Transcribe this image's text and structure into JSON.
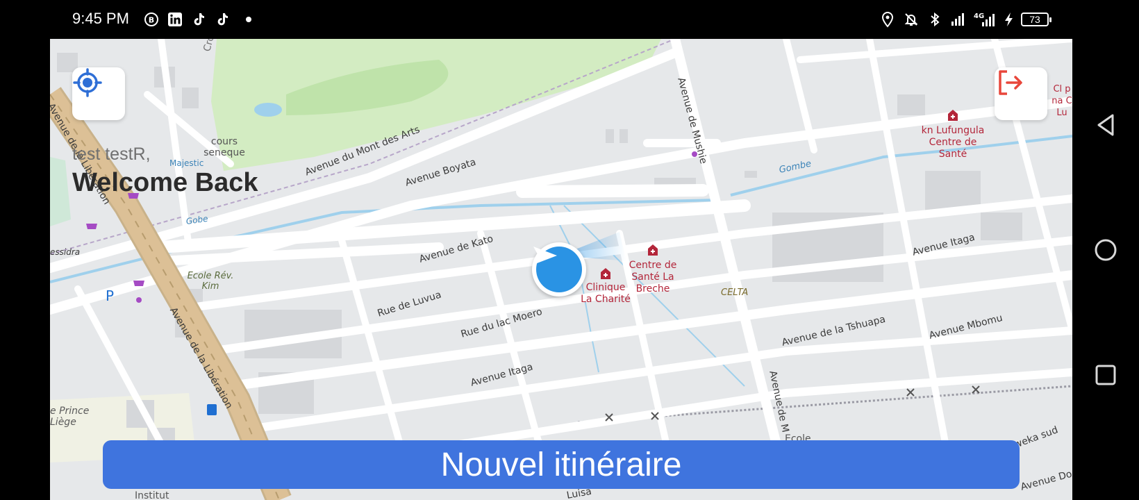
{
  "status_bar": {
    "time": "9:45 PM",
    "left_icons": [
      "b-circle-icon",
      "linkedin-icon",
      "tiktok-icon",
      "tiktok-icon"
    ],
    "right_icons": [
      "location-icon",
      "bell-off-icon",
      "bluetooth-icon",
      "signal-icon",
      "signal-4g-icon",
      "charging-icon"
    ],
    "network_label": "4G",
    "battery": "73"
  },
  "greeting": {
    "user": "test testR,",
    "title": "Welcome Back"
  },
  "map": {
    "streets": [
      "Avenue du Mont des Arts",
      "Avenue Boyata",
      "Avenue de Kato",
      "Rue de Luvua",
      "Rue du lac Moero",
      "Avenue Itaga",
      "Avenue Itaga",
      "Avenue de la Tshuapa",
      "Avenue Mbomu",
      "Avenue de Mushie",
      "Avenue de la Libération",
      "Avenue de la Libération",
      "Croix",
      "Gombe",
      "Gobe",
      "essidra",
      "Avenue de M",
      "mweka sud",
      "Avenue Do",
      "Luisa",
      "Rue",
      "Institut",
      "Ecole"
    ],
    "places": [
      "cours seneque",
      "Ecole Rév. Kim",
      "CELTA",
      "e Prince Liège",
      "Majestic"
    ],
    "pois": [
      {
        "name": "Clinique La Charité"
      },
      {
        "name": "Centre de Santé La Breche"
      },
      {
        "name": "kn Lufungula Centre de Santé"
      },
      {
        "name": "Cl p na C Lu"
      }
    ],
    "parking_label": "P",
    "colors": {
      "land": "#e6e8ea",
      "road": "#ffffff",
      "park": "#d3ecc2",
      "water": "#9fd0ec",
      "trunk": "#dcc096",
      "poi": "#b3263a"
    }
  },
  "buttons": {
    "locate_icon": "locate-target-icon",
    "logout_icon": "logout-icon",
    "new_route": "Nouvel itinéraire"
  },
  "nav_bar": {
    "icons": [
      "back-triangle-icon",
      "home-circle-icon",
      "recents-square-icon"
    ]
  },
  "accent_color": "#3f74de"
}
